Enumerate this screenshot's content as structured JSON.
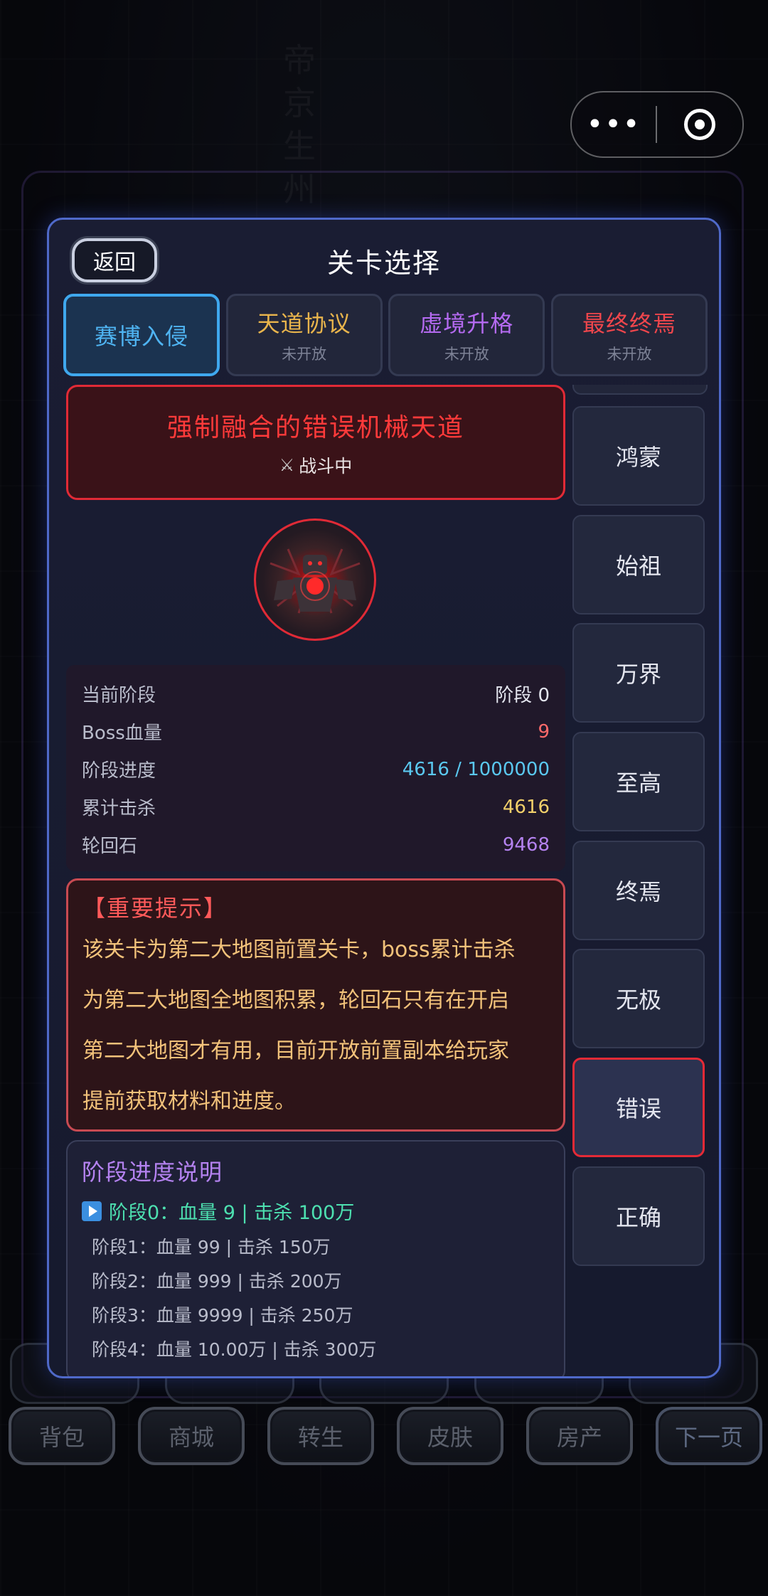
{
  "dialog": {
    "back_label": "返回",
    "title": "关卡选择"
  },
  "tabs": [
    {
      "label": "赛博入侵",
      "sub": "",
      "color": "#4fb4f2",
      "active": true
    },
    {
      "label": "天道协议",
      "sub": "未开放",
      "color": "#e8b44c"
    },
    {
      "label": "虚境升格",
      "sub": "未开放",
      "color": "#b46af0"
    },
    {
      "label": "最终终焉",
      "sub": "未开放",
      "color": "#f0464c"
    }
  ],
  "boss": {
    "name": "强制融合的错误机械天道",
    "status": "战斗中",
    "status_icon": "crossed-swords-icon"
  },
  "stats": [
    {
      "label": "当前阶段",
      "value": "阶段 0",
      "color": "#e4e6ef"
    },
    {
      "label": "Boss血量",
      "value": "9",
      "color": "#ff6a6a"
    },
    {
      "label": "阶段进度",
      "value": "4616 / 1000000",
      "color": "#5ac8f0"
    },
    {
      "label": "累计击杀",
      "value": "4616",
      "color": "#f2d06a"
    },
    {
      "label": "轮回石",
      "value": "9468",
      "color": "#b482f0"
    }
  ],
  "notice": {
    "title": "【重要提示】",
    "lines": [
      "该关卡为第二大地图前置关卡，boss累计击杀",
      "为第二大地图全地图积累，轮回石只有在开启",
      "第二大地图才有用，目前开放前置副本给玩家",
      "提前获取材料和进度。"
    ]
  },
  "phase": {
    "title": "阶段进度说明",
    "current": "阶段0：血量 9 | 击杀 100万",
    "lines": [
      "阶段1：血量 99 | 击杀 150万",
      "阶段2：血量 999 | 击杀 200万",
      "阶段3：血量 9999 | 击杀 250万",
      "阶段4：血量 10.00万 | 击杀 300万"
    ]
  },
  "maps": [
    {
      "label": "鸿蒙"
    },
    {
      "label": "始祖"
    },
    {
      "label": "万界"
    },
    {
      "label": "至高"
    },
    {
      "label": "终焉"
    },
    {
      "label": "无极"
    },
    {
      "label": "错误",
      "active": true
    },
    {
      "label": "正确"
    }
  ],
  "bottom_buttons": [
    "背包",
    "商城",
    "转生",
    "皮肤",
    "房产",
    "下一页"
  ],
  "colors": {
    "dialog_border": "#4f69c9",
    "boss_red": "#e12a36",
    "active_tab": "#3fa8ee"
  }
}
